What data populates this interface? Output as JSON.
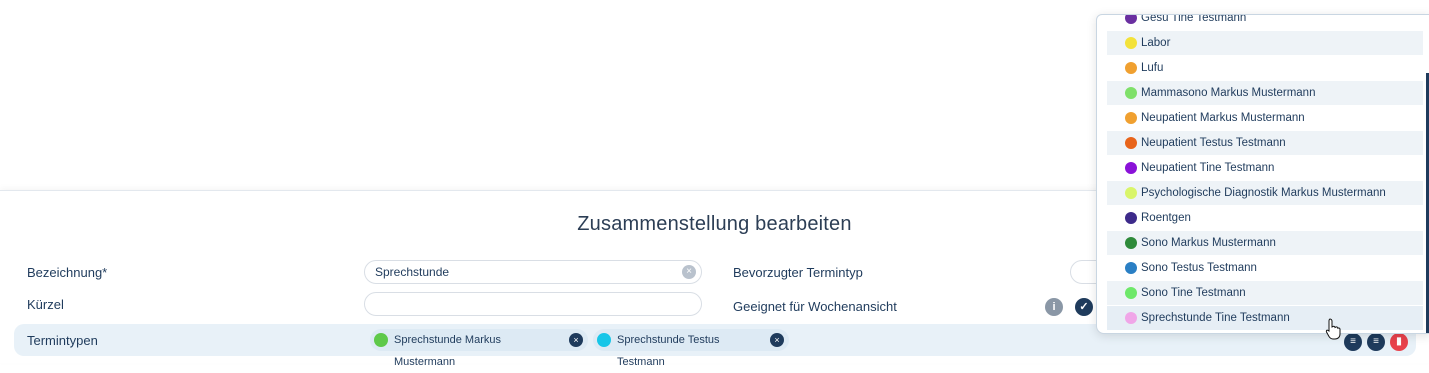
{
  "form": {
    "title": "Zusammenstellung bearbeiten",
    "bezeichnung_label": "Bezeichnung*",
    "bezeichnung_value": "Sprechstunde",
    "kuerzel_label": "Kürzel",
    "kuerzel_value": "",
    "bevorzugter_label": "Bevorzugter Termintyp",
    "geeignet_label": "Geeignet für Wochenansicht",
    "termintypen_label": "Termintypen",
    "chips": [
      {
        "label": "Sprechstunde Markus Mustermann",
        "color": "#5ec94a"
      },
      {
        "label": "Sprechstunde Testus Testmann",
        "color": "#17c6e8"
      }
    ]
  },
  "dropdown": {
    "items": [
      {
        "label": "Gesu Tine Testmann",
        "color": "#6a2fa0"
      },
      {
        "label": "Labor",
        "color": "#f3e23a"
      },
      {
        "label": "Lufu",
        "color": "#f0a030"
      },
      {
        "label": "Mammasono Markus Mustermann",
        "color": "#7fe06a"
      },
      {
        "label": "Neupatient Markus Mustermann",
        "color": "#f0a030"
      },
      {
        "label": "Neupatient Testus Testmann",
        "color": "#e8641a"
      },
      {
        "label": "Neupatient Tine Testmann",
        "color": "#8a12d8"
      },
      {
        "label": "Psychologische Diagnostik Markus Mustermann",
        "color": "#d9f56a"
      },
      {
        "label": "Roentgen",
        "color": "#3d2a8a"
      },
      {
        "label": "Sono Markus Mustermann",
        "color": "#2e8a3a"
      },
      {
        "label": "Sono Testus Testmann",
        "color": "#2a7fc4"
      },
      {
        "label": "Sono Tine Testmann",
        "color": "#6ee86a"
      },
      {
        "label": "Sprechstunde Tine Testmann",
        "color": "#f0a6e8"
      }
    ]
  },
  "icons": {
    "info": "i",
    "check": "✓",
    "clear": "×",
    "list": "≡",
    "playlist": "≡",
    "trash": "▮"
  },
  "colors": {
    "navy": "#1f3b5c",
    "trash_red": "#e8414b",
    "row_bg": "#e8f1f8"
  }
}
